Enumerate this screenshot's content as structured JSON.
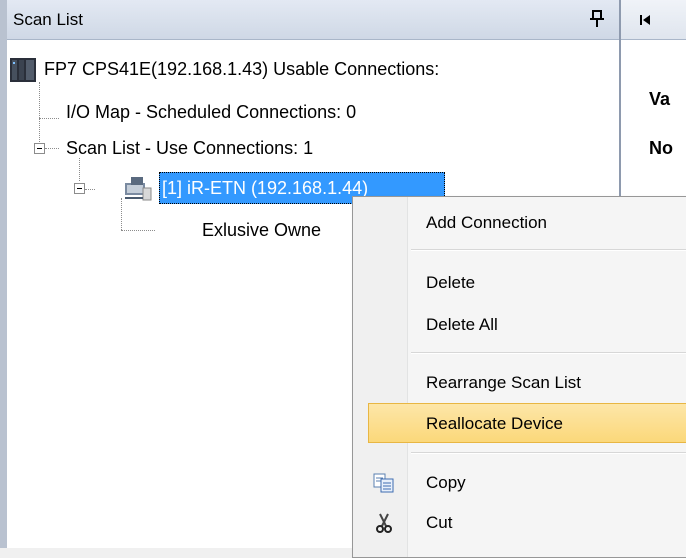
{
  "pane": {
    "title": "Scan List"
  },
  "right_pane": {
    "labels": [
      "Va",
      "No",
      "--"
    ]
  },
  "tree": {
    "root": "FP7 CPS41E(192.168.1.43)  Usable Connections:",
    "io_map": "I/O Map - Scheduled Connections: 0",
    "scan_list": "Scan List - Use Connections: 1",
    "device": "[1] iR-ETN  (192.168.1.44)",
    "exclusive_owner": "Exlusive Owne"
  },
  "context_menu": {
    "items": [
      {
        "label": "Add Connection",
        "icon": ""
      },
      {
        "label": "Delete",
        "icon": ""
      },
      {
        "label": "Delete All",
        "icon": ""
      },
      {
        "label": "Rearrange Scan List",
        "icon": ""
      },
      {
        "label": "Reallocate Device",
        "icon": "",
        "highlighted": true
      },
      {
        "label": "Copy",
        "icon": "copy-icon"
      },
      {
        "label": "Cut",
        "icon": "cut-icon"
      }
    ]
  },
  "colors": {
    "selection": "#3399ff",
    "menu_highlight": "#fbd87a",
    "header": "#cfd8e6"
  }
}
